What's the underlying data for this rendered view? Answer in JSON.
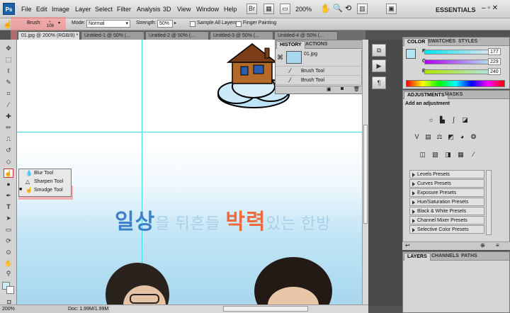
{
  "app": {
    "logo": "Ps",
    "workspace": "ESSENTIALS",
    "zoom": "200%"
  },
  "menu": [
    "File",
    "Edit",
    "Image",
    "Layer",
    "Select",
    "Filter",
    "Analysis",
    "3D",
    "View",
    "Window",
    "Help"
  ],
  "options": {
    "brush_label": "Brush:",
    "brush_size": "108",
    "mode_label": "Mode:",
    "mode_value": "Normal",
    "strength_label": "Strength:",
    "strength_value": "50%",
    "sample_all": "Sample All Layers",
    "finger_painting": "Finger Painting"
  },
  "tabs": [
    "01.jpg @ 200% (RGB/8) *",
    "Untitled-1 @ 50% (...",
    "Untitled-2 @ 50% (...",
    "Untitled-3 @ 50% (...",
    "Untitled-4 @ 50% (..."
  ],
  "canvas": {
    "text_blue": "일상",
    "text_mid1": "을 뒤흔들 ",
    "text_orange": "박력",
    "text_mid2": "있는 한방"
  },
  "flyout": [
    "Blur Tool",
    "Sharpen Tool",
    "Smudge Tool"
  ],
  "history": {
    "tabs": [
      "HISTORY",
      "ACTIONS"
    ],
    "snapshot": "01.jpg",
    "items": [
      "Brush Tool",
      "Brush Tool"
    ]
  },
  "color": {
    "tabs": [
      "COLOR",
      "SWATCHES",
      "STYLES"
    ],
    "r_label": "R",
    "g_label": "G",
    "b_label": "B",
    "r": "177",
    "g": "229",
    "b": "240",
    "swatch": "#b1e5f0"
  },
  "adjustments": {
    "tabs": [
      "ADJUSTMENTS",
      "MASKS"
    ],
    "heading": "Add an adjustment",
    "presets": [
      "Levels Presets",
      "Curves Presets",
      "Exposure Presets",
      "Hue/Saturation Presets",
      "Black & White Presets",
      "Channel Mixer Presets",
      "Selective Color Presets"
    ]
  },
  "layers": {
    "tabs": [
      "LAYERS",
      "CHANNELS",
      "PATHS"
    ]
  },
  "status": {
    "zoom": "200%",
    "doc": "Doc: 1.99M/1.99M"
  }
}
